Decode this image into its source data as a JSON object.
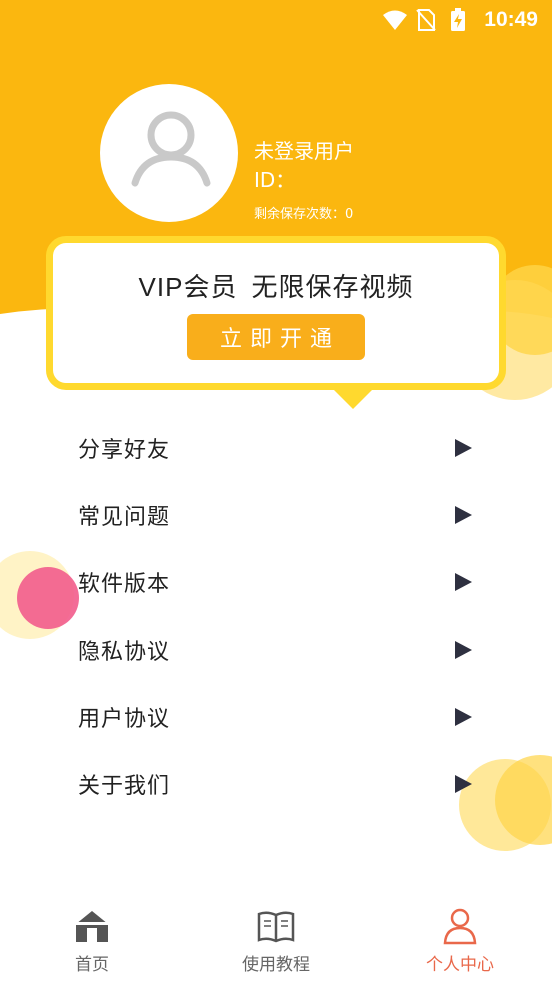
{
  "status_bar": {
    "time": "10:49",
    "icons": [
      "wifi-icon",
      "no-sim-icon",
      "battery-charging-icon"
    ]
  },
  "profile": {
    "avatar_icon": "user-avatar-icon",
    "username": "未登录用户",
    "id_label": "ID：",
    "remaining_saves": "剩余保存次数：0"
  },
  "vip": {
    "title_part1": "VIP会员",
    "title_part2": "无限保存视频",
    "button_label": "立即开通"
  },
  "menu": {
    "items": [
      {
        "label": "分享好友"
      },
      {
        "label": "常见问题"
      },
      {
        "label": "软件版本"
      },
      {
        "label": "隐私协议"
      },
      {
        "label": "用户协议"
      },
      {
        "label": "关于我们"
      }
    ]
  },
  "tabbar": {
    "tabs": [
      {
        "label": "首页",
        "icon": "home-icon",
        "active": false
      },
      {
        "label": "使用教程",
        "icon": "book-icon",
        "active": false
      },
      {
        "label": "个人中心",
        "icon": "person-icon",
        "active": true
      }
    ]
  },
  "colors": {
    "header_yellow": "#fbb70f",
    "vip_border": "#ffd92e",
    "button_orange": "#f9ae1b",
    "active_tab": "#e9684a",
    "arrow": "#2e3040"
  }
}
